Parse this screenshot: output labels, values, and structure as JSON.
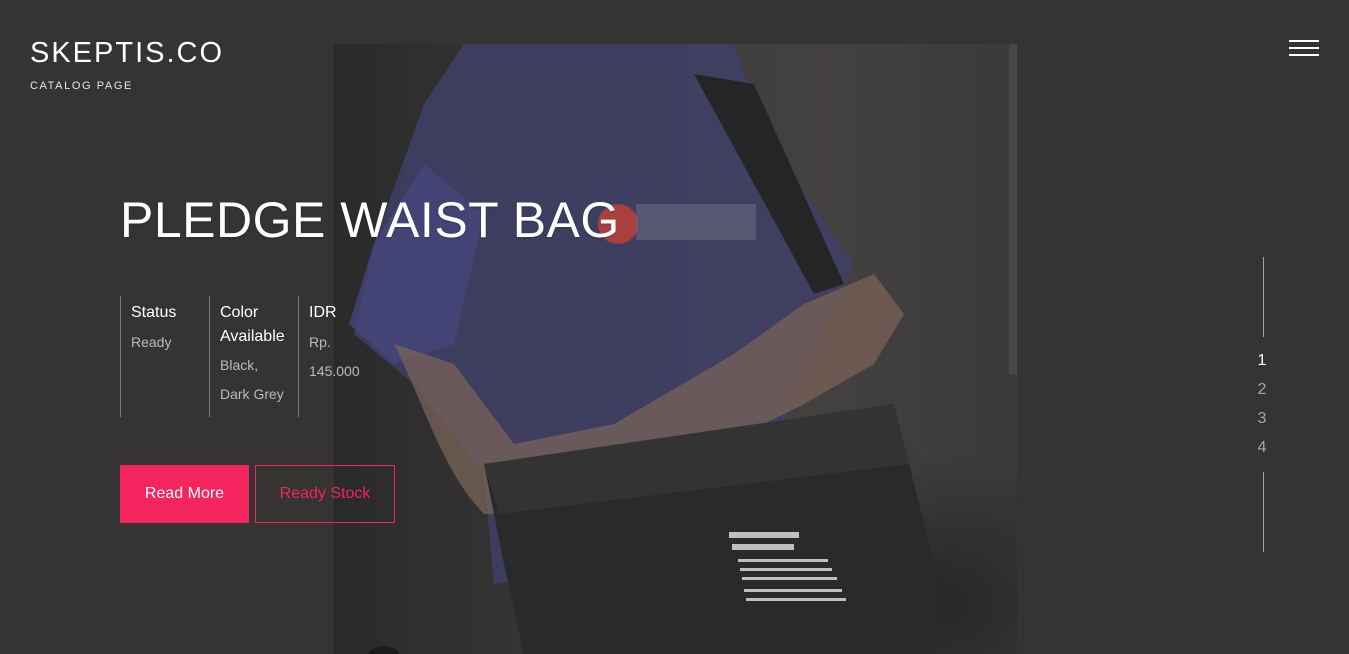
{
  "header": {
    "brand": "SKEPTIS.CO",
    "subtitle": "CATALOG PAGE",
    "menu_icon": "hamburger-menu-icon"
  },
  "hero": {
    "title": "PLEDGE WAIST BAG",
    "image_icon": "product-photo",
    "specs": [
      {
        "label": "Status",
        "value_lines": [
          "Ready"
        ]
      },
      {
        "label": "Color Available",
        "value_lines": [
          "Black,",
          "Dark Grey"
        ]
      },
      {
        "label": "IDR",
        "value_lines": [
          "Rp.",
          "145.000"
        ]
      }
    ],
    "buttons": {
      "primary": "Read More",
      "secondary": "Ready Stock"
    }
  },
  "pagination": {
    "pages": [
      "1",
      "2",
      "3",
      "4"
    ],
    "active": "1"
  },
  "colors": {
    "background": "#363433",
    "accent": "#f4245e",
    "text": "#ffffff",
    "muted": "#bdbab8"
  }
}
